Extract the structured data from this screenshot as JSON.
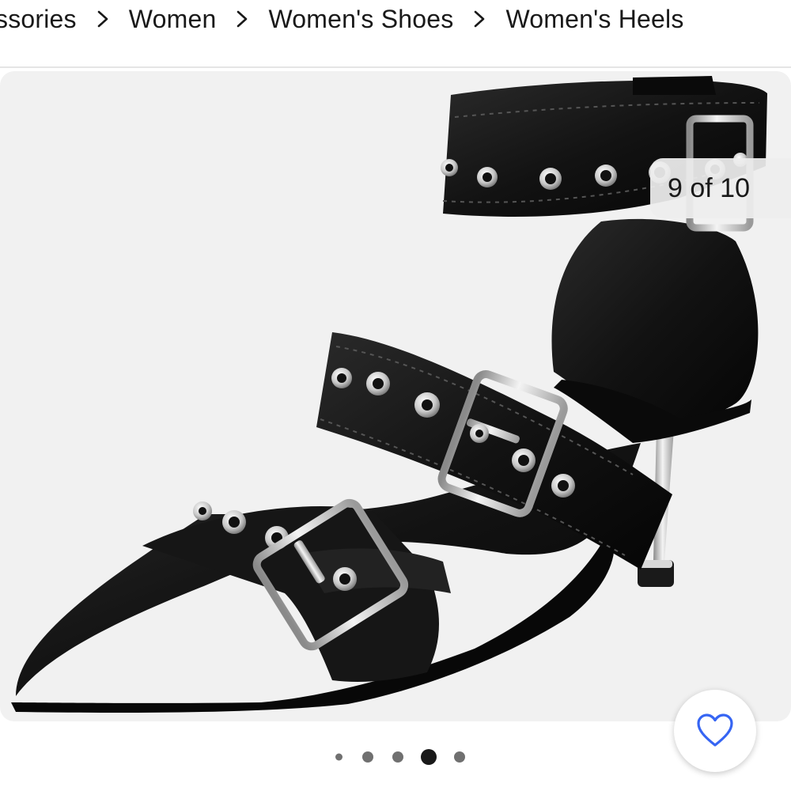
{
  "breadcrumb": {
    "items": [
      {
        "label": "ssories"
      },
      {
        "label": "Women"
      },
      {
        "label": "Women's Shoes"
      },
      {
        "label": "Women's Heels"
      }
    ]
  },
  "gallery": {
    "counter_text": "9 of 10",
    "dots": {
      "count": 5,
      "active_index": 3
    }
  },
  "watch": {
    "icon": "heart-outline-icon",
    "color": "#3665f3"
  },
  "colors": {
    "accent": "#3665f3",
    "text": "#191919",
    "background": "#f1f1f1"
  }
}
